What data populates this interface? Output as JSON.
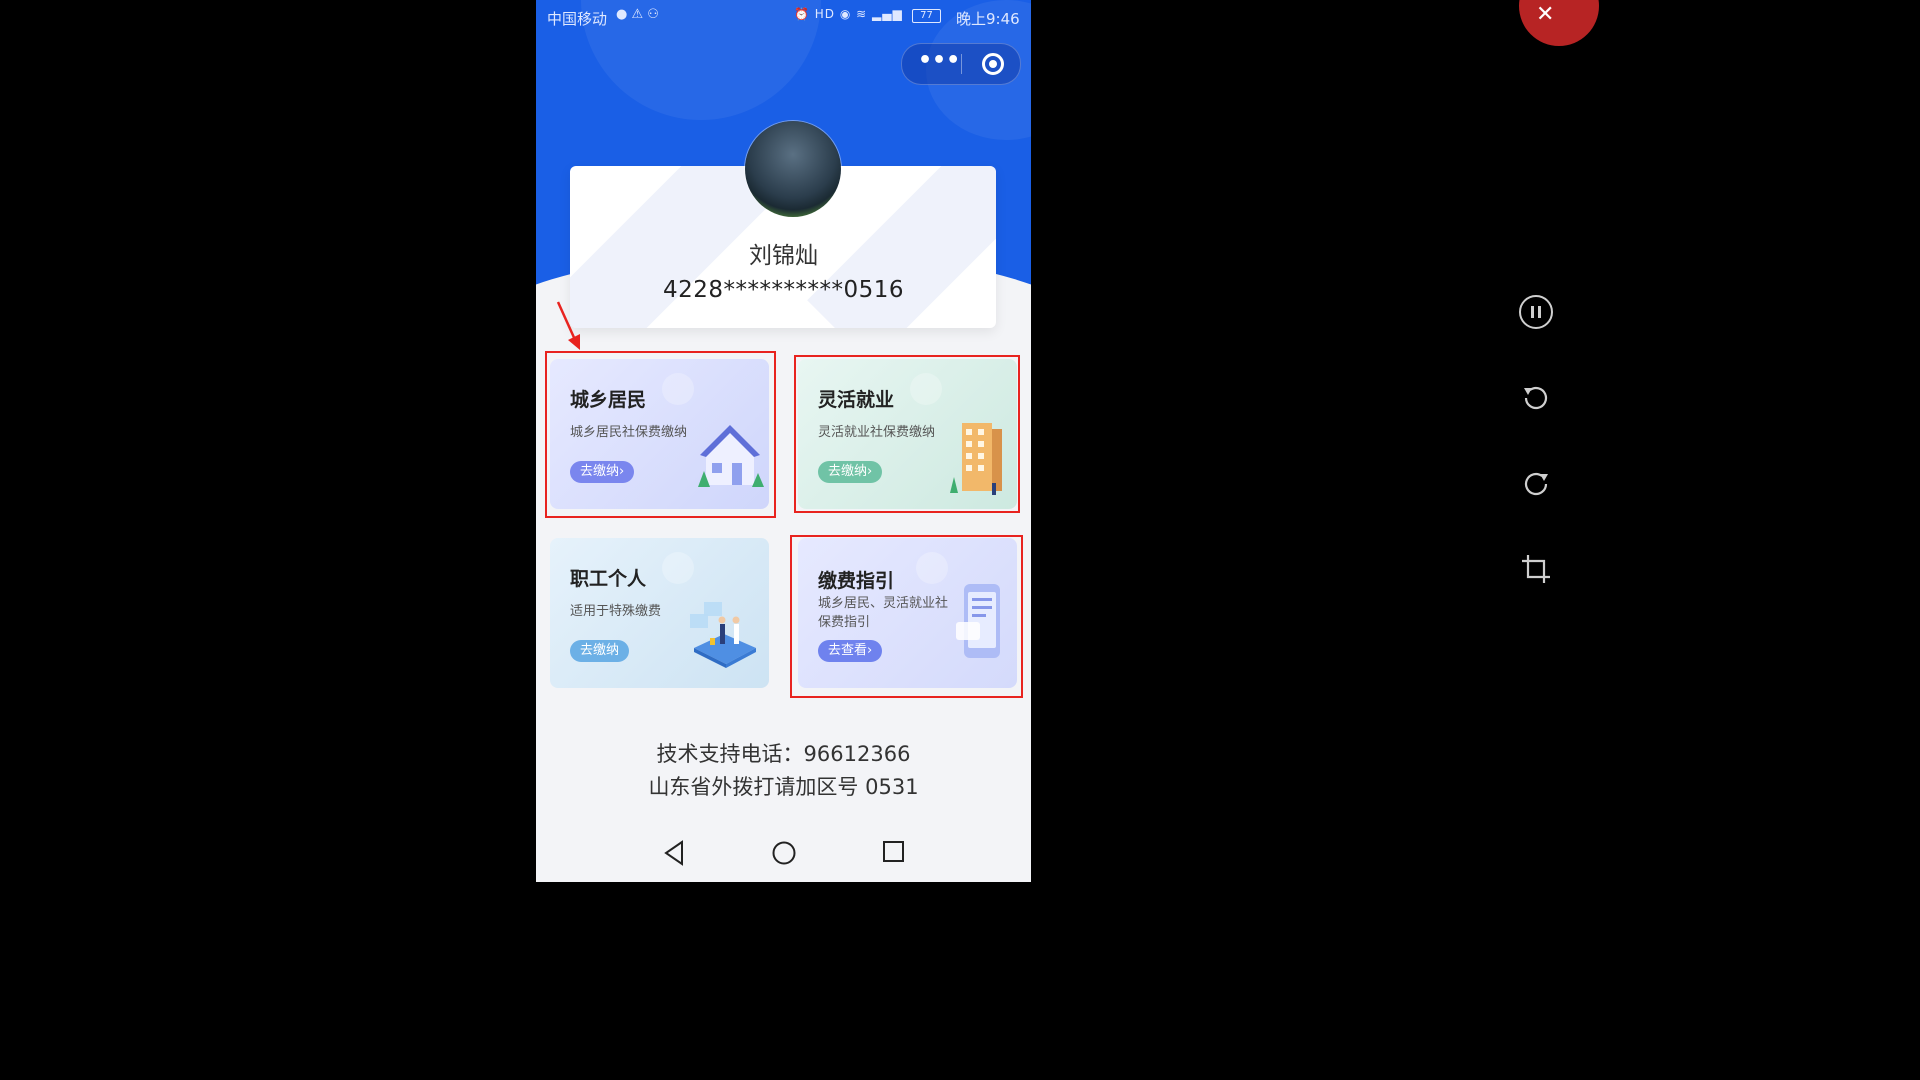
{
  "status_bar": {
    "carrier": "中国移动",
    "battery": "77",
    "time": "晚上9:46"
  },
  "profile": {
    "name": "刘锦灿",
    "id_number": "4228**********0516"
  },
  "cards": [
    {
      "title": "城乡居民",
      "desc": "城乡居民社保费缴纳",
      "button": "去缴纳›",
      "illustration": "house-icon"
    },
    {
      "title": "灵活就业",
      "desc": "灵活就业社保费缴纳",
      "button": "去缴纳›",
      "illustration": "building-icon"
    },
    {
      "title": "职工个人",
      "desc": "适用于特殊缴费",
      "button": "去缴纳",
      "illustration": "workers-icon"
    },
    {
      "title": "缴费指引",
      "desc": "城乡居民、灵活就业社保费指引",
      "button": "去查看›",
      "illustration": "phone-guide-icon"
    }
  ],
  "support": {
    "line1": "技术支持电话：96612366",
    "line2": "山东省外拨打请加区号 0531"
  },
  "colors": {
    "brand_blue": "#1a5fe6",
    "highlight_red": "#e8231f"
  }
}
